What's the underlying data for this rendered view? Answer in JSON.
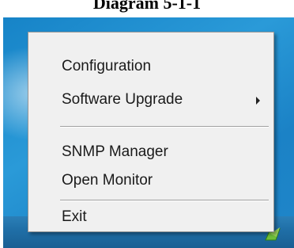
{
  "caption": "Diagram 5-1-1",
  "menu": {
    "items": [
      {
        "label": "Configuration"
      },
      {
        "label": "Software Upgrade",
        "has_submenu": true,
        "submenu_icon": "chevron-right-icon"
      },
      {
        "label": "SNMP Manager"
      },
      {
        "label": "Open Monitor"
      },
      {
        "label": "Exit"
      }
    ]
  },
  "tray": {
    "icon": "app-tray-icon"
  },
  "colors": {
    "desktop": "#1f8ccd",
    "taskbar": "#1f6ea6",
    "menu_background": "#f0f0f0",
    "menu_border": "#979797",
    "separator": "#a0a0a0"
  }
}
